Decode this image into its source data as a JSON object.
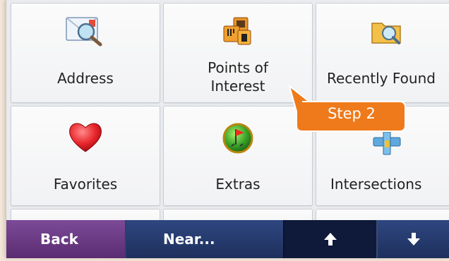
{
  "tiles": [
    {
      "label": "Address",
      "icon": "address-envelope-icon"
    },
    {
      "label": "Points of Interest",
      "line1": "Points of",
      "line2": "Interest",
      "icon": "points-of-interest-icon"
    },
    {
      "label": "Recently Found",
      "icon": "recently-found-folder-icon"
    },
    {
      "label": "Favorites",
      "icon": "heart-icon"
    },
    {
      "label": "Extras",
      "icon": "extras-flag-icon"
    },
    {
      "label": "Intersections",
      "icon": "intersection-signpost-icon"
    }
  ],
  "bottom_bar": {
    "back": "Back",
    "near": "Near...",
    "up_icon": "arrow-up-icon",
    "down_icon": "arrow-down-icon"
  },
  "callout": {
    "text": "Step 2",
    "color": "#ee7a1b"
  },
  "colors": {
    "back_button": "#6b3a86",
    "near_button": "#233766",
    "bar_background": "#0f1a3a"
  }
}
